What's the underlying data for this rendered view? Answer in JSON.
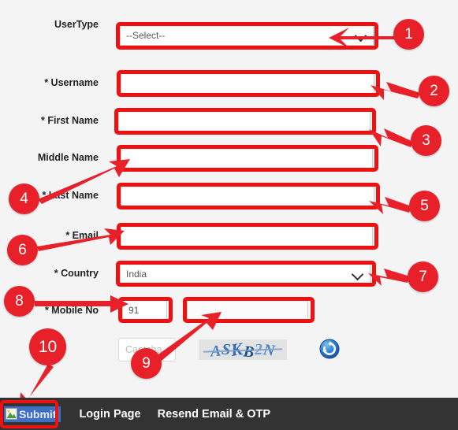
{
  "page": {
    "background_color": "#f4f4f4",
    "annotation_color": "#ee1111",
    "badge_color": "#e8202a"
  },
  "form": {
    "rows": [
      {
        "id": "usertype",
        "label": "UserType",
        "control": "select",
        "value": "--Select--",
        "required": false
      },
      {
        "id": "username",
        "label": "* Username",
        "control": "text",
        "value": "",
        "required": true
      },
      {
        "id": "firstname",
        "label": "* First Name",
        "control": "text",
        "value": "",
        "required": true
      },
      {
        "id": "middlename",
        "label": "Middle Name",
        "control": "text",
        "value": "",
        "required": false
      },
      {
        "id": "lastname",
        "label": "* Last Name",
        "control": "text",
        "value": "",
        "required": true
      },
      {
        "id": "email",
        "label": "* Email",
        "control": "text",
        "value": "",
        "required": true
      },
      {
        "id": "country",
        "label": "* Country",
        "control": "select",
        "value": "India",
        "required": true
      },
      {
        "id": "mobile",
        "label": "* Mobile No",
        "control": "split",
        "country_code_value": "91",
        "number_value": "",
        "required": true
      }
    ]
  },
  "captcha": {
    "input_placeholder": "Captcha",
    "input_value": "",
    "image_text": "ASKB2N",
    "refresh_icon": "refresh-icon"
  },
  "bottom_bar": {
    "submit_label": "Submit",
    "submit_icon": "broken-image-icon",
    "links": [
      {
        "label": "Login Page"
      },
      {
        "label": "Resend Email & OTP"
      }
    ]
  },
  "annotations": {
    "badges": [
      {
        "n": "1"
      },
      {
        "n": "2"
      },
      {
        "n": "3"
      },
      {
        "n": "4"
      },
      {
        "n": "5"
      },
      {
        "n": "6"
      },
      {
        "n": "7"
      },
      {
        "n": "8"
      },
      {
        "n": "9"
      },
      {
        "n": "10"
      }
    ]
  }
}
